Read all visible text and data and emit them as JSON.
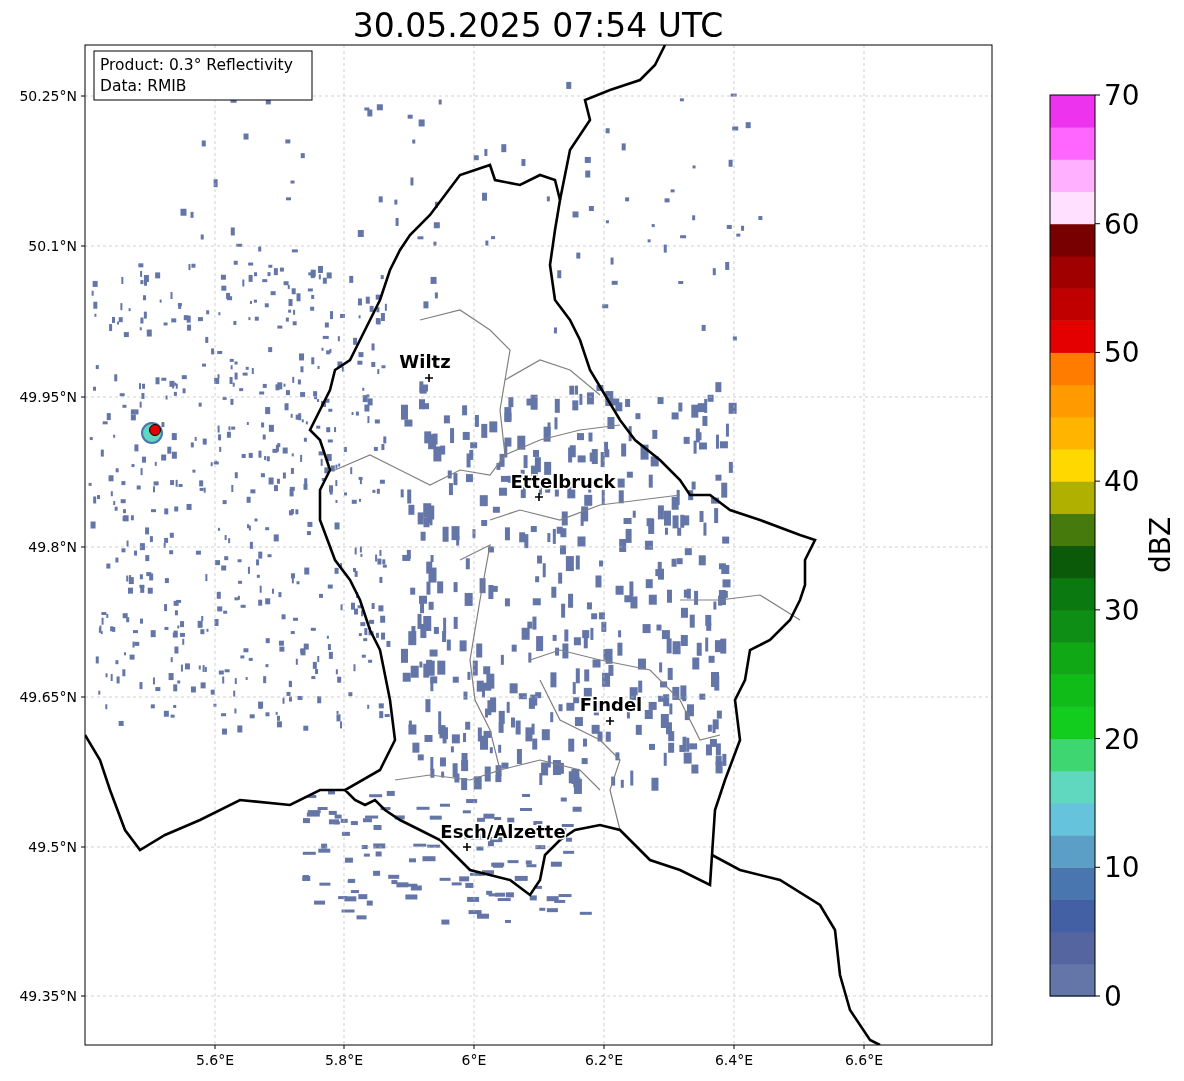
{
  "title": "30.05.2025 07:54 UTC",
  "info_box": [
    "Product: 0.3° Reflectivity",
    "Data: RMIB"
  ],
  "map": {
    "xticks": [
      "5.6°E",
      "5.8°E",
      "6°E",
      "6.2°E",
      "6.4°E",
      "6.6°E"
    ],
    "yticks": [
      "50.25°N",
      "50.1°N",
      "49.95°N",
      "49.8°N",
      "49.65°N",
      "49.5°N",
      "49.35°N"
    ],
    "cities": [
      {
        "name": "Wiltz"
      },
      {
        "name": "Ettelbruck"
      },
      {
        "name": "Findel"
      },
      {
        "name": "Esch/Alzette"
      }
    ]
  },
  "colorbar": {
    "label": "dBZ",
    "ticks": [
      "70",
      "60",
      "50",
      "40",
      "30",
      "20",
      "10",
      "0"
    ],
    "levels": [
      {
        "color": "#6476a8"
      },
      {
        "color": "#5465a0"
      },
      {
        "color": "#4360a4"
      },
      {
        "color": "#4a76b0"
      },
      {
        "color": "#5b9ec6"
      },
      {
        "color": "#66c3dc"
      },
      {
        "color": "#60d8c0"
      },
      {
        "color": "#3ed670"
      },
      {
        "color": "#12cc1e"
      },
      {
        "color": "#10bc18"
      },
      {
        "color": "#10a814"
      },
      {
        "color": "#0e8e14"
      },
      {
        "color": "#0a7a10"
      },
      {
        "color": "#0a5a0a"
      },
      {
        "color": "#467a0c"
      },
      {
        "color": "#b0b000"
      },
      {
        "color": "#ffd800"
      },
      {
        "color": "#ffb400"
      },
      {
        "color": "#ff9a00"
      },
      {
        "color": "#ff7c00"
      },
      {
        "color": "#e40000"
      },
      {
        "color": "#c00000"
      },
      {
        "color": "#a00000"
      },
      {
        "color": "#780000"
      },
      {
        "color": "#ffe0ff"
      },
      {
        "color": "#ffb0ff"
      },
      {
        "color": "#ff66ff"
      },
      {
        "color": "#ee33ee"
      }
    ]
  }
}
